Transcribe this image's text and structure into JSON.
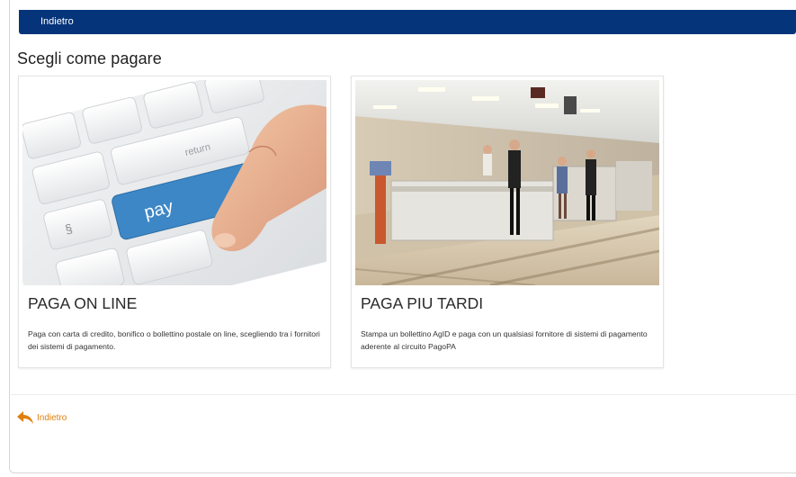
{
  "header": {
    "back_label": "Indietro"
  },
  "page": {
    "title": "Scegli come pagare"
  },
  "options": [
    {
      "title": "PAGA ON LINE",
      "description": "Paga con carta di credito, bonifico o bollettino postale on line, scegliendo tra i fornitori dei sistemi di pagamento.",
      "image_key_label": "pay",
      "image_key_label2": "return"
    },
    {
      "title": "PAGA PIU TARDI",
      "description": "Stampa un bollettino AgID e paga con un qualsiasi fornitore di sistemi di pagamento aderente al circuito PagoPA"
    }
  ],
  "footer": {
    "back_label": "Indietro"
  },
  "colors": {
    "header_bg": "#05347a",
    "link": "#e07f0c",
    "pay_key": "#3d87c6"
  }
}
